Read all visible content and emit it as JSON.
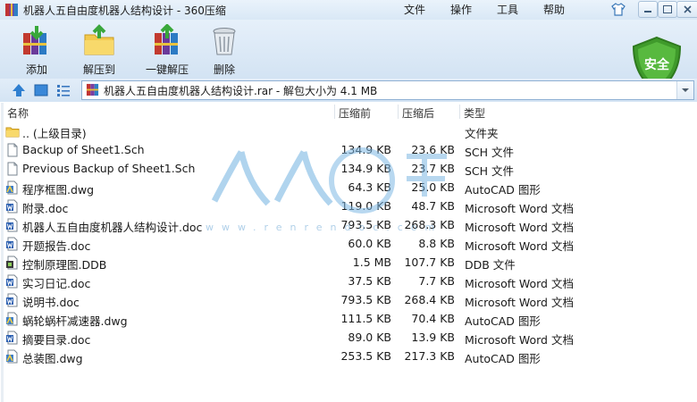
{
  "window": {
    "title": "机器人五自由度机器人结构设计 - 360压缩",
    "menu": [
      "文件",
      "操作",
      "工具",
      "帮助"
    ]
  },
  "toolbar": {
    "buttons": [
      {
        "label": "添加",
        "icon": "add-books-icon"
      },
      {
        "label": "解压到",
        "icon": "extract-folder-icon"
      },
      {
        "label": "一键解压",
        "icon": "one-click-extract-icon"
      },
      {
        "label": "删除",
        "icon": "trash-can-icon"
      }
    ],
    "security_badge": "安全"
  },
  "address": {
    "path": "机器人五自由度机器人结构设计.rar - 解包大小为 4.1 MB"
  },
  "columns": {
    "name": "名称",
    "compressed": "压缩前",
    "uncompressed": "压缩后",
    "type": "类型"
  },
  "files": [
    {
      "name": ".. (上级目录)",
      "compressed": "",
      "uncompressed": "",
      "type": "文件夹",
      "icon": "folder-icon"
    },
    {
      "name": "Backup of Sheet1.Sch",
      "compressed": "134.9 KB",
      "uncompressed": "23.6 KB",
      "type": "SCH 文件",
      "icon": "blank-file-icon"
    },
    {
      "name": "Previous Backup of Sheet1.Sch",
      "compressed": "134.9 KB",
      "uncompressed": "23.7 KB",
      "type": "SCH 文件",
      "icon": "blank-file-icon"
    },
    {
      "name": "程序框图.dwg",
      "compressed": "64.3 KB",
      "uncompressed": "25.0 KB",
      "type": "AutoCAD 图形",
      "icon": "dwg-file-icon"
    },
    {
      "name": "附录.doc",
      "compressed": "119.0 KB",
      "uncompressed": "48.7 KB",
      "type": "Microsoft Word 文档",
      "icon": "word-file-icon"
    },
    {
      "name": "机器人五自由度机器人结构设计.doc",
      "compressed": "793.5 KB",
      "uncompressed": "268.3 KB",
      "type": "Microsoft Word 文档",
      "icon": "word-file-icon"
    },
    {
      "name": "开题报告.doc",
      "compressed": "60.0 KB",
      "uncompressed": "8.8 KB",
      "type": "Microsoft Word 文档",
      "icon": "word-file-icon"
    },
    {
      "name": "控制原理图.DDB",
      "compressed": "1.5 MB",
      "uncompressed": "107.7 KB",
      "type": "DDB 文件",
      "icon": "ddb-file-icon"
    },
    {
      "name": "实习日记.doc",
      "compressed": "37.5 KB",
      "uncompressed": "7.7 KB",
      "type": "Microsoft Word 文档",
      "icon": "word-file-icon"
    },
    {
      "name": "说明书.doc",
      "compressed": "793.5 KB",
      "uncompressed": "268.4 KB",
      "type": "Microsoft Word 文档",
      "icon": "word-file-icon"
    },
    {
      "name": "蜗轮蜗杆减速器.dwg",
      "compressed": "111.5 KB",
      "uncompressed": "70.4 KB",
      "type": "AutoCAD 图形",
      "icon": "dwg-file-icon"
    },
    {
      "name": "摘要目录.doc",
      "compressed": "89.0 KB",
      "uncompressed": "13.9 KB",
      "type": "Microsoft Word 文档",
      "icon": "word-file-icon"
    },
    {
      "name": "总装图.dwg",
      "compressed": "253.5 KB",
      "uncompressed": "217.3 KB",
      "type": "AutoCAD 图形",
      "icon": "dwg-file-icon"
    }
  ],
  "watermark": {
    "text": "人人文库",
    "url": "www.renrendoc.com"
  },
  "colors": {
    "titlebar": "#dbe9f6",
    "accent": "#2a6fb6",
    "shield": "#3f9a2b",
    "watermark": "#5aa0d6"
  }
}
